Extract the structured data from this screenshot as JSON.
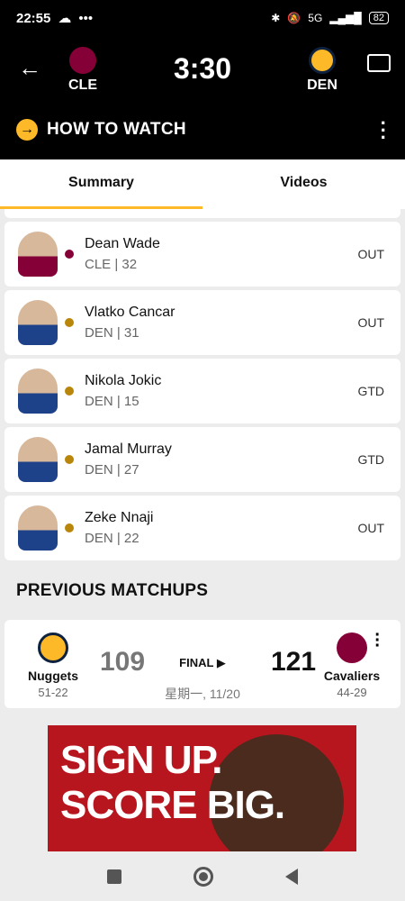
{
  "status_bar": {
    "time": "22:55",
    "dots": "•••",
    "battery": "82",
    "network": "5G",
    "left_icons": [
      "cloud-icon"
    ],
    "right_icons": [
      "bluetooth-icon",
      "mute-icon",
      "volte-icon",
      "signal-icon",
      "battery-icon"
    ]
  },
  "header": {
    "clock": "3:30",
    "home": {
      "abbr": "CLE",
      "color": "#860038"
    },
    "away": {
      "abbr": "DEN",
      "color": "#fdb927"
    },
    "how_to_watch": "HOW TO WATCH"
  },
  "tabs": [
    {
      "label": "Summary",
      "active": true
    },
    {
      "label": "Videos",
      "active": false
    }
  ],
  "injuries": [
    {
      "name": "Dean Wade",
      "meta": "CLE | 32",
      "status": "OUT",
      "team": "cle"
    },
    {
      "name": "Vlatko Cancar",
      "meta": "DEN | 31",
      "status": "OUT",
      "team": "den"
    },
    {
      "name": "Nikola Jokic",
      "meta": "DEN | 15",
      "status": "GTD",
      "team": "den"
    },
    {
      "name": "Jamal Murray",
      "meta": "DEN | 27",
      "status": "GTD",
      "team": "den"
    },
    {
      "name": "Zeke Nnaji",
      "meta": "DEN | 22",
      "status": "OUT",
      "team": "den"
    }
  ],
  "previous": {
    "title": "PREVIOUS MATCHUPS",
    "left": {
      "name": "Nuggets",
      "record": "51-22",
      "score": "109"
    },
    "right": {
      "name": "Cavaliers",
      "record": "44-29",
      "score": "121"
    },
    "final": "FINAL ▶",
    "date": "星期一, 11/20"
  },
  "ad": {
    "line1": "SIGN UP.",
    "line2": "SCORE BIG."
  },
  "colors": {
    "accent": "#fdb927",
    "cle": "#860038",
    "den": "#0e2240"
  }
}
